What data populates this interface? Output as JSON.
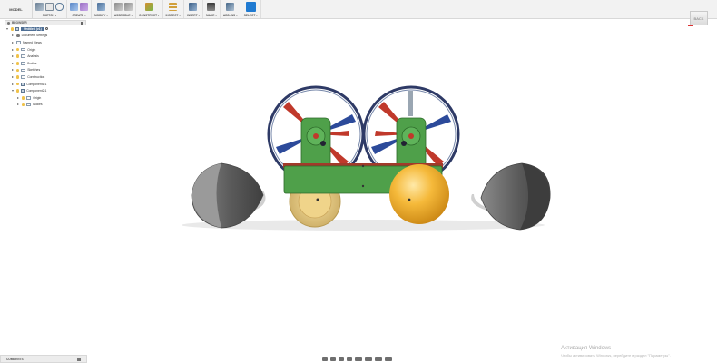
{
  "toolbar": {
    "workspace": "MODEL",
    "groups": [
      {
        "label": "SKETCH ▾"
      },
      {
        "label": "CREATE ▾"
      },
      {
        "label": "MODIFY ▾"
      },
      {
        "label": "ASSEMBLE ▾"
      },
      {
        "label": "CONSTRUCT ▾"
      },
      {
        "label": "INSPECT ▾"
      },
      {
        "label": "INSERT ▾"
      },
      {
        "label": "MAKE ▾"
      },
      {
        "label": "ADD-INS ▾"
      },
      {
        "label": "SELECT ▾"
      }
    ]
  },
  "viewcube": {
    "face": "BACK"
  },
  "browser": {
    "title": "BROWSER",
    "root": "Untitled (v1)",
    "items": [
      {
        "label": "Document Settings",
        "icon": "gear-icon"
      },
      {
        "label": "Named Views",
        "icon": "folder-icon"
      },
      {
        "label": "Origin",
        "icon": "folder-icon"
      },
      {
        "label": "Analysis",
        "icon": "folder-icon"
      },
      {
        "label": "Bodies",
        "icon": "folder-icon"
      },
      {
        "label": "Sketches",
        "icon": "folder-icon"
      },
      {
        "label": "Construction",
        "icon": "folder-icon"
      },
      {
        "label": "Component1:1",
        "icon": "component-icon"
      },
      {
        "label": "Component2:1",
        "icon": "component-icon"
      },
      {
        "label": "Origin",
        "icon": "folder-icon"
      },
      {
        "label": "Bodies",
        "icon": "folder-icon"
      }
    ]
  },
  "comments": {
    "title": "COMMENTS"
  },
  "watermark": {
    "line1": "Активация Windows",
    "line2": "Чтобы активировать Windows, перейдите в раздел \"Параметры\"."
  }
}
